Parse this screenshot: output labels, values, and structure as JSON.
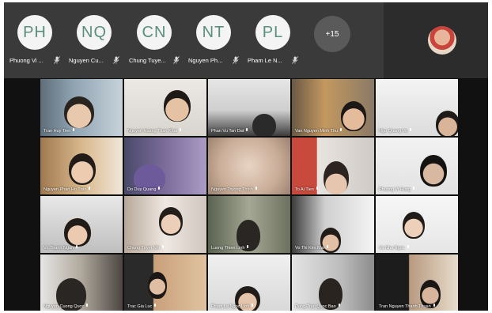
{
  "participants_strip": [
    {
      "initials": "PH",
      "name": "Phuong Vi ..."
    },
    {
      "initials": "NQ",
      "name": "Nguyen Cu..."
    },
    {
      "initials": "CN",
      "name": "Chung Tuye..."
    },
    {
      "initials": "NT",
      "name": "Nguyen Ph..."
    },
    {
      "initials": "PL",
      "name": "Pham Le N..."
    }
  ],
  "more_participants": "+15",
  "grid": [
    {
      "name": "Tran Huy Tien"
    },
    {
      "name": "Nguyen Hoang Tuan Khai"
    },
    {
      "name": "Phan Vu Tan Dat"
    },
    {
      "name": "Van Nguyen Minh Thu"
    },
    {
      "name": "Ngo Quang Vu"
    },
    {
      "name": "Nguyen Phan Ho Tran"
    },
    {
      "name": "Do Duy Quang"
    },
    {
      "name": "Nguyen Truong Thinh"
    },
    {
      "name": "To Ai Tien"
    },
    {
      "name": "Phuong Vi Hung"
    },
    {
      "name": "Vo Thanh Ngan"
    },
    {
      "name": "Chung Tuyet Nhi"
    },
    {
      "name": "Luong Thien Linh"
    },
    {
      "name": "Vo Thi Kim Mai"
    },
    {
      "name": "Vu Nhu Ngoc"
    },
    {
      "name": "Nguyen Cuong Quoc"
    },
    {
      "name": "Trac Gia Luc"
    },
    {
      "name": "Pham Le Ngoc Linh"
    },
    {
      "name": "Dang Tran Quoc Bao"
    },
    {
      "name": "Tran Nguyen Thanh Thuan"
    }
  ],
  "colors": {
    "strip_bg": "#3a3a3a",
    "avatar_text": "#5a8f7d",
    "frame_bg": "#111111"
  }
}
